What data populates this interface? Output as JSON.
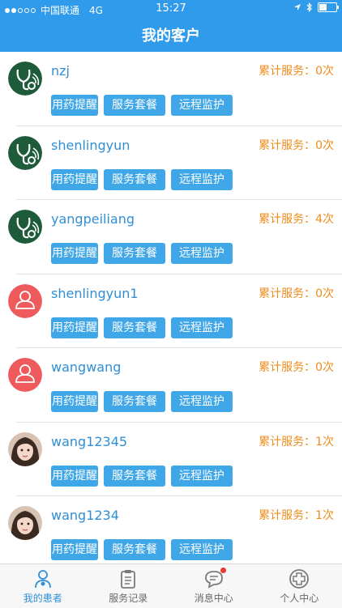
{
  "status_bar": {
    "carrier": "中国联通",
    "network": "4G",
    "time": "15:27"
  },
  "header": {
    "title": "我的客户"
  },
  "count_prefix": "累计服务：",
  "buttons": [
    "用药提醒",
    "服务套餐",
    "远程监护"
  ],
  "customers": [
    {
      "name": "nzj",
      "count": "0次",
      "avatar": "green-stethoscope"
    },
    {
      "name": "shenlingyun",
      "count": "0次",
      "avatar": "green-stethoscope"
    },
    {
      "name": "yangpeiliang",
      "count": "4次",
      "avatar": "green-stethoscope"
    },
    {
      "name": "shenlingyun1",
      "count": "0次",
      "avatar": "red-default"
    },
    {
      "name": "wangwang",
      "count": "0次",
      "avatar": "red-default"
    },
    {
      "name": "wang12345",
      "count": "1次",
      "avatar": "photo"
    },
    {
      "name": "wang1234",
      "count": "1次",
      "avatar": "photo"
    }
  ],
  "tabbar": [
    {
      "label": "我的患者",
      "icon": "patient-icon",
      "active": true
    },
    {
      "label": "服务记录",
      "icon": "clipboard-icon",
      "active": false
    },
    {
      "label": "消息中心",
      "icon": "chat-icon",
      "active": false,
      "badge": true
    },
    {
      "label": "个人中心",
      "icon": "plus-circle-icon",
      "active": false
    }
  ],
  "colors": {
    "header": "#2f9bea",
    "button": "#3fa6e8",
    "count": "#ee8c1c",
    "name": "#2f8fd6",
    "active_tab": "#2f8fd6"
  }
}
